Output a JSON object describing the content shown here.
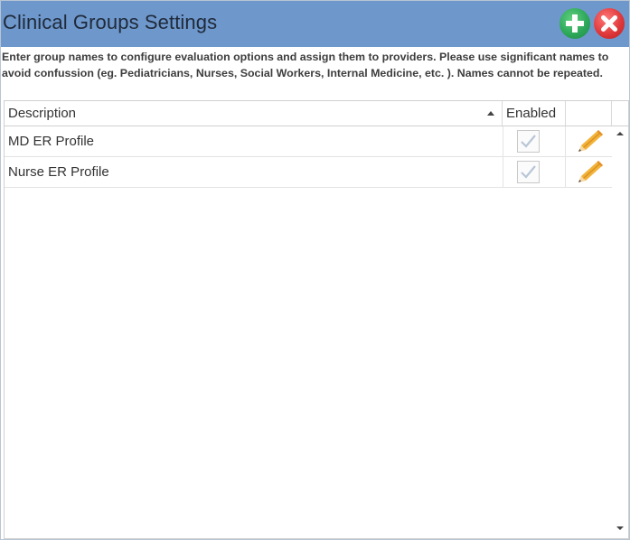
{
  "window": {
    "title": "Clinical Groups Settings",
    "add_button_icon": "plus-icon",
    "close_button_icon": "close-icon",
    "header_color": "#6e97cb",
    "add_color": "#2ea85a",
    "close_color": "#e0393b"
  },
  "instructions": "Enter group names to configure evaluation options and assign them to providers. Please use significant names to avoid confussion (eg. Pediatricians, Nurses, Social Workers, Internal Medicine, etc. ). Names cannot be repeated.",
  "grid": {
    "columns": {
      "description": "Description",
      "enabled": "Enabled",
      "sort_icon": "sort-ascending-icon"
    },
    "rows": [
      {
        "description": "MD ER Profile",
        "enabled": true,
        "edit_icon": "pencil-icon"
      },
      {
        "description": "Nurse ER Profile",
        "enabled": true,
        "edit_icon": "pencil-icon"
      }
    ]
  }
}
